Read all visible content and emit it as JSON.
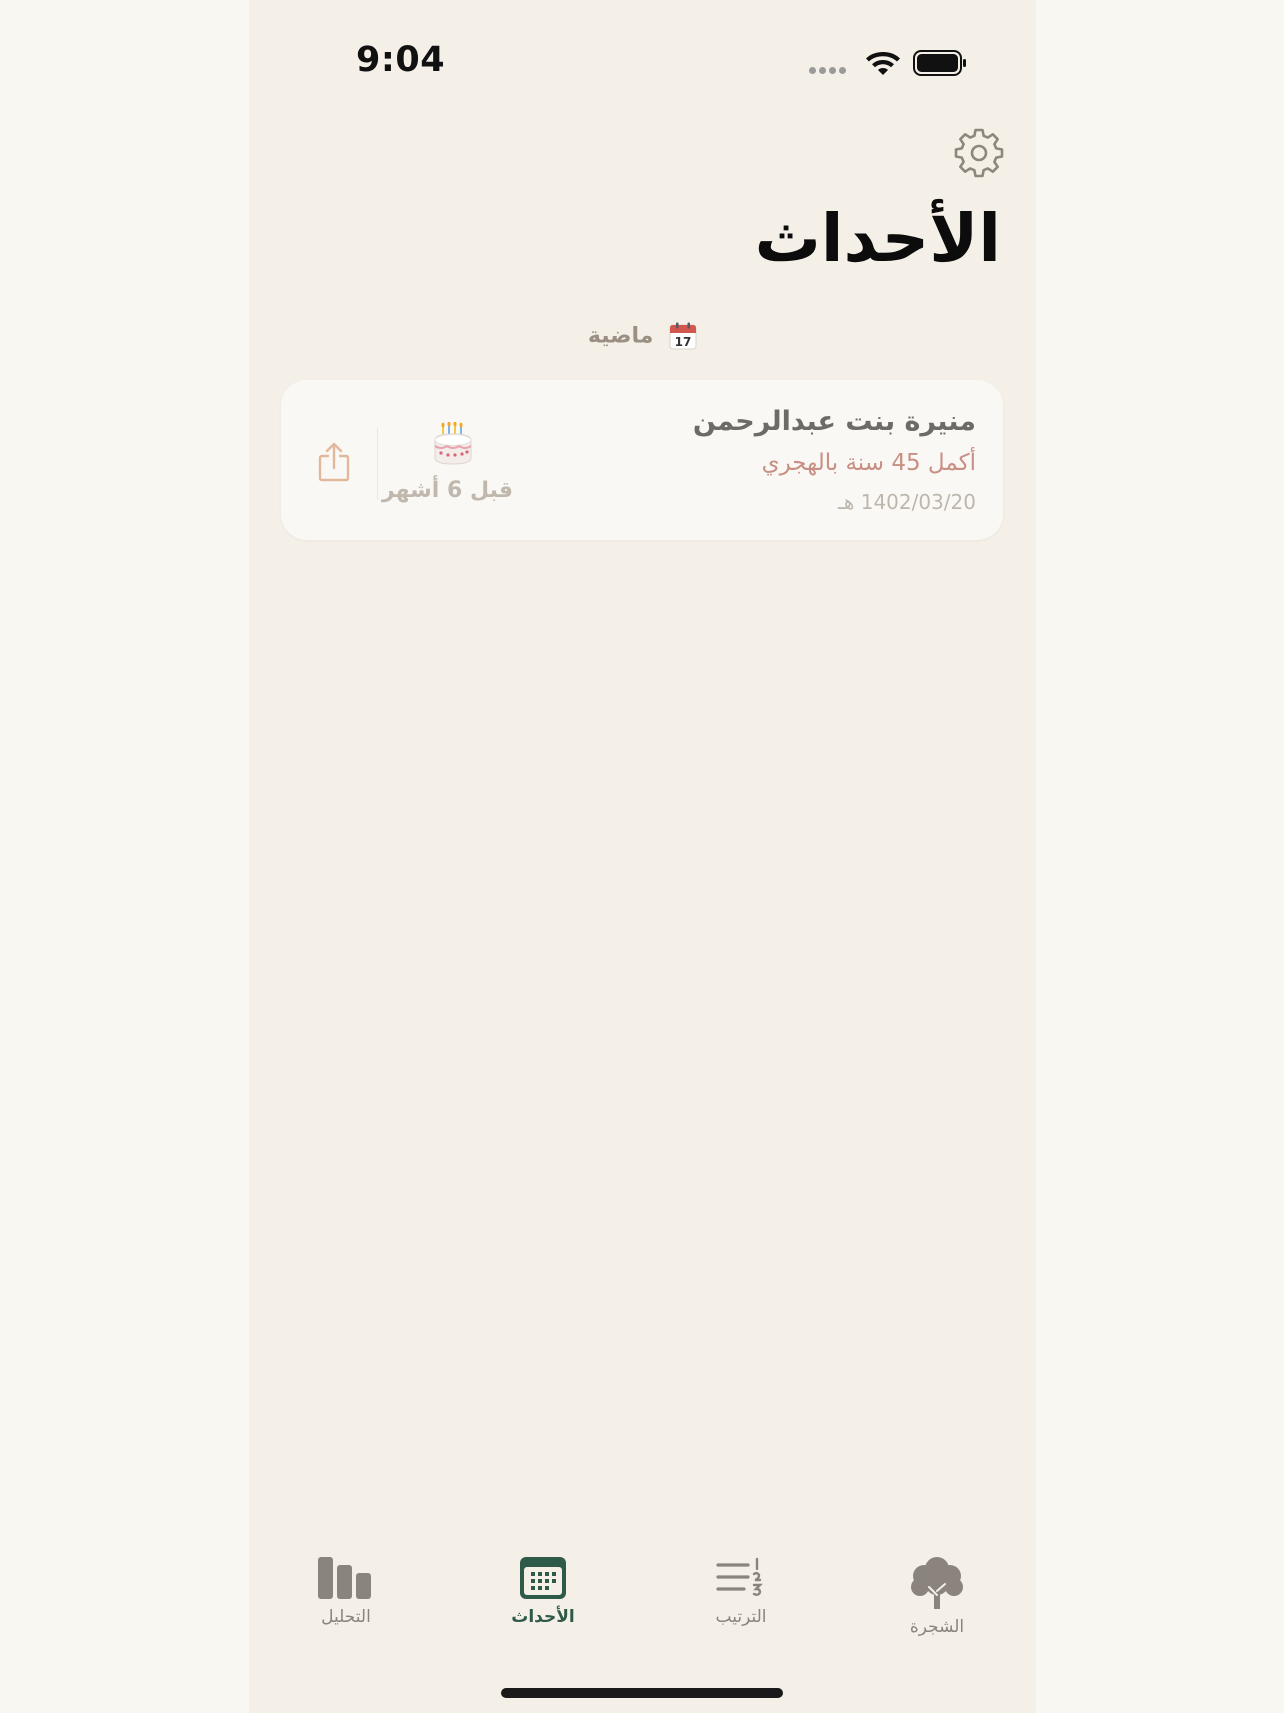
{
  "status_bar": {
    "time": "9:04"
  },
  "header": {
    "settings_icon": "gear-icon",
    "title": "الأحداث"
  },
  "section": {
    "icon": "calendar-icon",
    "calendar_day": "17",
    "label": "ماضية"
  },
  "events": [
    {
      "name": "منيرة بنت عبدالرحمن",
      "description": "أكمل 45 سنة بالهجري",
      "date": "1402/03/20 هـ",
      "icon": "birthday-cake-icon",
      "relative_time": "قبل 6 أشهر",
      "share_icon": "share-icon"
    }
  ],
  "tab_bar": {
    "active_tab": "events",
    "tabs": [
      {
        "id": "analysis",
        "label": "التحليل",
        "icon": "bar-chart-icon"
      },
      {
        "id": "events",
        "label": "الأحداث",
        "icon": "calendar-grid-icon"
      },
      {
        "id": "ranking",
        "label": "الترتيب",
        "icon": "ordered-list-icon"
      },
      {
        "id": "tree",
        "label": "الشجرة",
        "icon": "tree-icon"
      }
    ]
  },
  "colors": {
    "background": "#f4f0e8",
    "card": "#faf8f4",
    "accent_active_tab": "#2f5a49",
    "event_description": "#c88f84",
    "share_icon": "#e0b89c"
  }
}
